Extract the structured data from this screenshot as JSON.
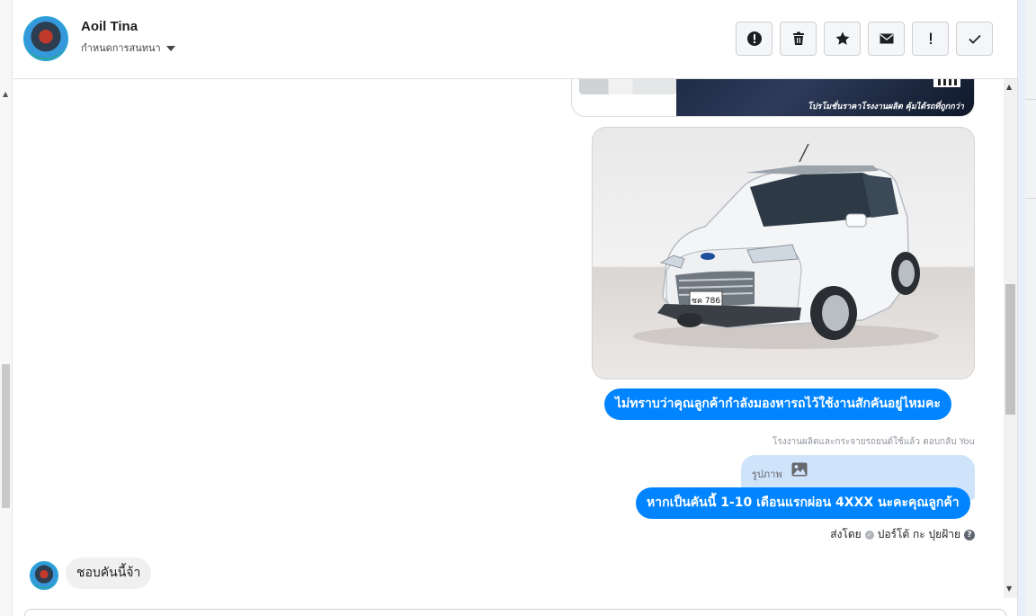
{
  "header": {
    "contact_name": "Aoil Tina",
    "contact_sub": "กำหนดการสนทนา",
    "tools": [
      {
        "name": "report-icon"
      },
      {
        "name": "trash-icon"
      },
      {
        "name": "star-icon"
      },
      {
        "name": "mail-icon"
      },
      {
        "name": "important-icon"
      },
      {
        "name": "check-icon"
      }
    ]
  },
  "messages": {
    "banner_promo": "โปรโมชั่นราคาโรงงานผลิต คุ้มได้รถที่ถูกกว่า",
    "outgoing_1": "ไม่ทราบว่าคุณลูกค้ากำลังมองหารถไว้ใช้งานสักคันอยู่ไหมคะ",
    "reply_note": "โรงงานผลิตและกระจายรถยนต์ใช้แล้ว ตอบกลับ You",
    "reply_quote_label": "รูปภาพ",
    "outgoing_2": "หากเป็นคันนี้ 1-10 เดือนแรกผ่อน 4XXX นะคะคุณลูกค้า",
    "sent_by_prefix": "ส่งโดย",
    "sent_by_name": "ปอร์โต้ กะ ปุยฝ้าย",
    "incoming_1": "ชอบคันนี้จ้า",
    "plate_text": "ชค 786"
  }
}
